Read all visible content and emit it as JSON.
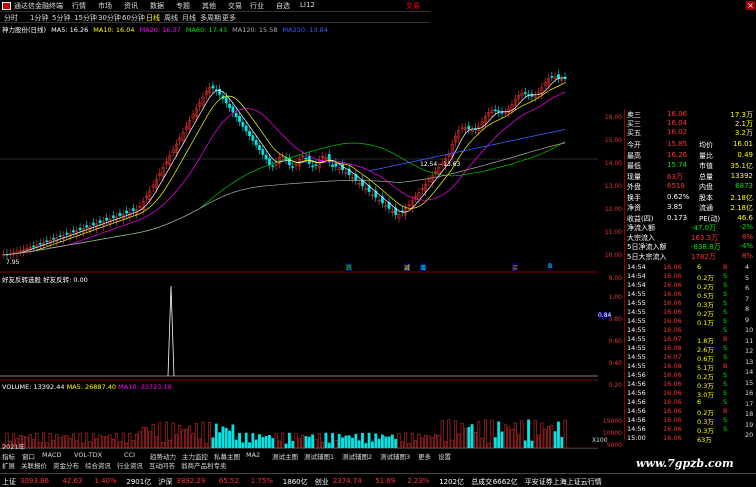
{
  "titlebar": {
    "app_title": "通达信金融终端",
    "menus": [
      "行情",
      "市场",
      "资讯",
      "数据",
      "专题",
      "其他",
      "交易",
      "行业",
      "自选",
      "LI12"
    ],
    "right_text": "交易"
  },
  "toolbar": {
    "items": [
      "分时",
      "1分钟",
      "5分钟",
      "15分钟",
      "30分钟",
      "60分钟",
      "日线",
      "周线",
      "月线",
      "多周期",
      "更多"
    ],
    "active": "日线"
  },
  "stock": {
    "name": "神力股份(日线)",
    "label": "MA5: 18.26",
    "ma": [
      {
        "label": "MA5: 16.26",
        "color": "#ffffff"
      },
      {
        "label": "MA10: 16.04",
        "color": "#ffff00"
      },
      {
        "label": "MA20: 16.37",
        "color": "#ff00ff"
      },
      {
        "label": "MA60: 17.43",
        "color": "#00ff00"
      },
      {
        "label": "MA120: 15.58",
        "color": "#aaaaaa"
      },
      {
        "label": "MA250: 13.84",
        "color": "#3c5cff"
      }
    ]
  },
  "chart_labels": {
    "low_price": "7.95",
    "mid_range": "12.54 - 13.63",
    "signals": [
      "跌",
      "减",
      "增",
      "买",
      "B"
    ]
  },
  "indicator": {
    "title": "好友反转选股 好友反转: 0.00"
  },
  "volume": {
    "title": "VOLUME: 13392.44",
    "ma5": "MA5: 26887.40",
    "ma10": "MA10: 23723.18"
  },
  "axis": {
    "price_ticks": [
      "16.00",
      "15.00",
      "14.00",
      "13.00",
      "12.00",
      "11.00",
      "10.00",
      "9.00",
      "8.00"
    ],
    "ind_ticks": [
      "1.00",
      "0.80",
      "0.60",
      "0.40",
      "0.20"
    ],
    "ind_marker": "0.84",
    "vol_ticks": [
      "15000",
      "10000",
      "5000",
      "X100"
    ],
    "year": "2021年",
    "months": [
      "2",
      "3",
      "4",
      "5",
      "6",
      "7",
      "8",
      "9"
    ]
  },
  "quotes": {
    "book": [
      {
        "label": "卖三",
        "price": "16.06",
        "vol": "17.3万"
      },
      {
        "label": "买三",
        "price": "16.04",
        "vol": "2.1万"
      },
      {
        "label": "买五",
        "price": "16.02",
        "vol": "3.2万"
      }
    ],
    "stats": [
      {
        "l1": "今开",
        "v1": "15.85",
        "l2": "均价",
        "v2": "16.01"
      },
      {
        "l1": "最高",
        "v1": "16.26",
        "l2": "量比",
        "v2": "0.49"
      },
      {
        "l1": "最低",
        "v1": "15.74",
        "l2": "市值",
        "v2": "35.1亿"
      },
      {
        "l1": "现量",
        "v1": "63万",
        "l2": "总量",
        "v2": "13392"
      },
      {
        "l1": "外盘",
        "v1": "6519",
        "l2": "内盘",
        "v2": "6873"
      },
      {
        "l1": "换手",
        "v1": "0.62%",
        "l2": "股本",
        "v2": "2.18亿"
      },
      {
        "l1": "净资",
        "v1": "3.85",
        "l2": "流通",
        "v2": "2.18亿"
      },
      {
        "l1": "收益(四)",
        "v1": "0.173",
        "l2": "PE(动)",
        "v2": "46.6"
      }
    ],
    "flows": [
      {
        "label": "净流入额",
        "value": "-47.0万",
        "pct": "-2%"
      },
      {
        "label": "大宗流入",
        "value": "163.3万",
        "pct": "8%"
      },
      {
        "label": "5日净流入额",
        "value": "-838.8万",
        "pct": "-4%"
      },
      {
        "label": "5日大宗流入",
        "value": "1782万",
        "pct": "8%"
      }
    ]
  },
  "ticks": [
    {
      "t": "14:54",
      "p": "16.06",
      "v": "6",
      "f": "B"
    },
    {
      "t": "14:54",
      "p": "16.06",
      "v": "0.2万",
      "f": "S"
    },
    {
      "t": "14:54",
      "p": "16.06",
      "v": "0.2万",
      "f": "S"
    },
    {
      "t": "14:55",
      "p": "16.06",
      "v": "0.5万",
      "f": "S"
    },
    {
      "t": "14:55",
      "p": "16.06",
      "v": "0.3万",
      "f": "S"
    },
    {
      "t": "14:55",
      "p": "16.06",
      "v": "0.2万",
      "f": "S"
    },
    {
      "t": "14:55",
      "p": "16.06",
      "v": "0.1万",
      "f": "S"
    },
    {
      "t": "14:55",
      "p": "16.06",
      "v": "",
      "f": "S"
    },
    {
      "t": "14:55",
      "p": "16.07",
      "v": "1.8万",
      "f": "B"
    },
    {
      "t": "14:55",
      "p": "16.08",
      "v": "2.6万",
      "f": "S"
    },
    {
      "t": "14:55",
      "p": "16.07",
      "v": "0.6万",
      "f": "S"
    },
    {
      "t": "14:55",
      "p": "16.08",
      "v": "5.1万",
      "f": "B"
    },
    {
      "t": "14:56",
      "p": "16.06",
      "v": "0.2万",
      "f": "S"
    },
    {
      "t": "14:56",
      "p": "16.06",
      "v": "0.3万",
      "f": "S"
    },
    {
      "t": "14:56",
      "p": "16.06",
      "v": "3.0万",
      "f": "S"
    },
    {
      "t": "14:56",
      "p": "16.06",
      "v": "6",
      "f": "S"
    },
    {
      "t": "14:56",
      "p": "16.06",
      "v": "0.2万",
      "f": "B"
    },
    {
      "t": "14:56",
      "p": "16.06",
      "v": "0.3万",
      "f": "S"
    },
    {
      "t": "14:56",
      "p": "16.06",
      "v": "0.3万",
      "f": "S"
    },
    {
      "t": "15:00",
      "p": "16.06",
      "v": "63万",
      "f": ""
    }
  ],
  "rightstrip": [
    "4",
    "5",
    "6",
    "7",
    "8",
    "9",
    "10",
    "11",
    "12",
    "13",
    "14",
    "15",
    "16",
    "17",
    "18",
    "19",
    "20"
  ],
  "tabs_row1": [
    "指标",
    "窗口",
    "MACD",
    "VOL-TDX",
    "CCI",
    "趋势动力",
    "主力监控",
    "私募主图",
    "MA2",
    "测试主图",
    "测试辅图1",
    "测试辅图2",
    "测试辅图3",
    "更多",
    "设置"
  ],
  "tabs_row2": [
    "扩展",
    "关联报价",
    "资金分布",
    "综合资讯",
    "行业资讯",
    "互动问答",
    "翁商产品利专卖"
  ],
  "statusbar": [
    {
      "t": "上证",
      "c": "white"
    },
    {
      "t": "3093.86",
      "c": "red"
    },
    {
      "t": "42.63",
      "c": "red"
    },
    {
      "t": "1.40%",
      "c": "red"
    },
    {
      "t": "2901亿",
      "c": "white"
    },
    {
      "t": "沪深",
      "c": "white"
    },
    {
      "t": "3892.29",
      "c": "red"
    },
    {
      "t": "65.52",
      "c": "red"
    },
    {
      "t": "1.75%",
      "c": "red"
    },
    {
      "t": "1860亿",
      "c": "white"
    },
    {
      "t": "创业",
      "c": "white"
    },
    {
      "t": "2374.74",
      "c": "red"
    },
    {
      "t": "51.69",
      "c": "red"
    },
    {
      "t": "2.23%",
      "c": "red"
    },
    {
      "t": "1202亿",
      "c": "white"
    },
    {
      "t": "总成交",
      "c": "white"
    },
    {
      "t": "6662亿",
      "c": "white"
    },
    {
      "t": "平安证券上海上证云行情",
      "c": "white"
    }
  ],
  "watermark": "www.7gpzb.com",
  "colors": {
    "up": "#ff3232",
    "down": "#00e6e6",
    "bg": "#000000"
  }
}
